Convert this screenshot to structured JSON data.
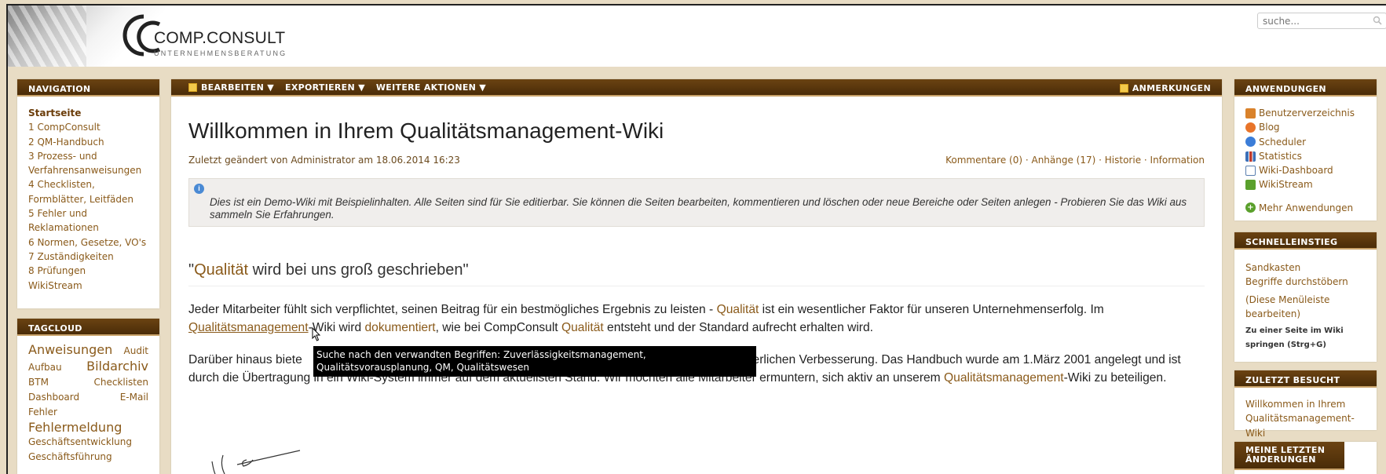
{
  "header": {
    "logo_name": "COMP.CONSULT",
    "logo_sub": "UNTERNEHMENSBERATUNG",
    "search_placeholder": "suche..."
  },
  "nav": {
    "title": "NAVIGATION",
    "items": [
      {
        "label": "Startseite",
        "current": true
      },
      {
        "label": "1 CompConsult"
      },
      {
        "label": "2 QM-Handbuch"
      },
      {
        "label": "3 Prozess- und Verfahrensanweisungen"
      },
      {
        "label": "4 Checklisten, Formblätter, Leitfäden"
      },
      {
        "label": "5 Fehler und Reklamationen"
      },
      {
        "label": "6 Normen, Gesetze, VO's"
      },
      {
        "label": "7 Zuständigkeiten"
      },
      {
        "label": "8 Prüfungen"
      },
      {
        "label": "WikiStream"
      }
    ]
  },
  "tagcloud": {
    "title": "TAGCLOUD",
    "tags": [
      "Anweisungen",
      "Audit",
      "Aufbau",
      "Bildarchiv",
      "BTM",
      "Checklisten",
      "Dashboard",
      "E-Mail",
      "Fehler",
      "Fehlermeldung",
      "Geschäftsentwicklung",
      "Geschäftsführung"
    ]
  },
  "toolbar": {
    "edit": "BEARBEITEN ▼",
    "export": "EXPORTIEREN ▼",
    "more": "WEITERE AKTIONEN ▼",
    "notes": "ANMERKUNGEN"
  },
  "page": {
    "title": "Willkommen in Ihrem Qualitätsmanagement-Wiki",
    "modified": "Zuletzt geändert von Administrator am 18.06.2014 16:23",
    "comments": "Kommentare (0)",
    "attachments": "Anhänge (17)",
    "history": "Historie",
    "information": "Information",
    "sep": " · ",
    "info_box": "Dies ist ein Demo-Wiki mit Beispielinhalten. Alle Seiten sind für Sie editierbar. Sie können die Seiten bearbeiten, kommentieren und löschen oder neue Bereiche oder Seiten anlegen - Probieren Sie das Wiki aus sammeln Sie Erfahrungen.",
    "heading_open": "\"",
    "heading_link": "Qualität",
    "heading_rest": " wird bei uns groß geschrieben\"",
    "p1": {
      "t1": "Jeder Mitarbeiter fühlt sich verpflichtet, seinen Beitrag für ein bestmögliches Ergebnis zu leisten - ",
      "l1": "Qualität",
      "t2": " ist ein wesentlicher Faktor für unseren Unternehmenserfolg. Im ",
      "l2": "Qualitätsmanagement",
      "t3": "-Wiki wird ",
      "l3": "dokumentiert",
      "t4": ", wie bei CompConsult ",
      "l4": "Qualität",
      "t5": " entsteht und der Standard aufrecht erhalten wird."
    },
    "p2": {
      "t1": "Darüber hinaus biete",
      "t2": "kontinuierlichen Verbesserung. Das Handbuch wurde am 1.März 2001 angelegt und ist durch die Übertragung in ein Wiki-System immer auf dem aktuellsten Stand. Wir möchten alle Mitarbeiter ermuntern, sich aktiv an unserem ",
      "l1": "Qualitätsmanagement",
      "t3": "-Wiki zu beteiligen."
    },
    "tooltip": "Suche nach den verwandten Begriffen: Zuverlässigkeitsmanagement, Qualitätsvorausplanung, QM, Qualitätswesen"
  },
  "apps": {
    "title": "ANWENDUNGEN",
    "items": [
      {
        "label": "Benutzerverzeichnis",
        "icon": "users-icon",
        "color": "#d9822b"
      },
      {
        "label": "Blog",
        "icon": "blog-icon",
        "color": "#e8742a"
      },
      {
        "label": "Scheduler",
        "icon": "clock-icon",
        "color": "#3b7dd8"
      },
      {
        "label": "Statistics",
        "icon": "chart-icon",
        "color": "#3b6fb8"
      },
      {
        "label": "Wiki-Dashboard",
        "icon": "dashboard-icon",
        "color": "#5a7fb0"
      },
      {
        "label": "WikiStream",
        "icon": "puzzle-icon",
        "color": "#5aa02c"
      }
    ],
    "more": "Mehr Anwendungen"
  },
  "quick": {
    "title": "SCHNELLEINSTIEG",
    "sandbox": "Sandkasten",
    "browse": "Begriffe durchstöbern",
    "edit_menu": "(Diese Menüleiste bearbeiten)",
    "jump": "Zu einer Seite im Wiki springen (Strg+G)"
  },
  "recent": {
    "title": "ZULETZT BESUCHT",
    "item": "Willkommen in Ihrem Qualitätsmanagement-Wiki"
  },
  "mychanges": {
    "title": "MEINE LETZTEN ÄNDERUNGEN"
  }
}
